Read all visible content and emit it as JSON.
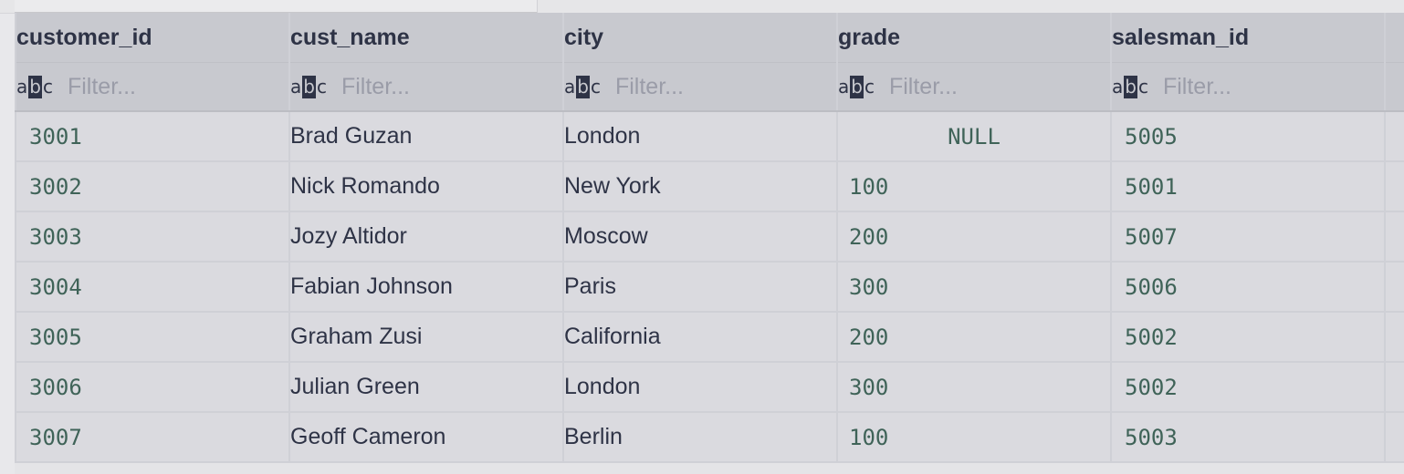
{
  "columns": [
    {
      "name": "customer_id",
      "type": "num"
    },
    {
      "name": "cust_name",
      "type": "txt"
    },
    {
      "name": "city",
      "type": "txt"
    },
    {
      "name": "grade",
      "type": "num"
    },
    {
      "name": "salesman_id",
      "type": "num"
    }
  ],
  "filter": {
    "placeholder": "Filter...",
    "icon_text": [
      "a",
      "b",
      "c"
    ]
  },
  "rows": [
    [
      "3001",
      "Brad Guzan",
      "London",
      "NULL",
      "5005"
    ],
    [
      "3002",
      "Nick Romando",
      "New York",
      "100",
      "5001"
    ],
    [
      "3003",
      "Jozy Altidor",
      "Moscow",
      "200",
      "5007"
    ],
    [
      "3004",
      "Fabian Johnson",
      "Paris",
      "300",
      "5006"
    ],
    [
      "3005",
      "Graham Zusi",
      "California",
      "200",
      "5002"
    ],
    [
      "3006",
      "Julian Green",
      "London",
      "300",
      "5002"
    ],
    [
      "3007",
      "Geoff Cameron",
      "Berlin",
      "100",
      "5003"
    ]
  ],
  "colors": {
    "header_bg": "#c8c9cf",
    "row_bg": "#dadadf",
    "header_text": "#2e3346",
    "numeric_text": "#3f6358",
    "placeholder_text": "#9a9ca8"
  }
}
